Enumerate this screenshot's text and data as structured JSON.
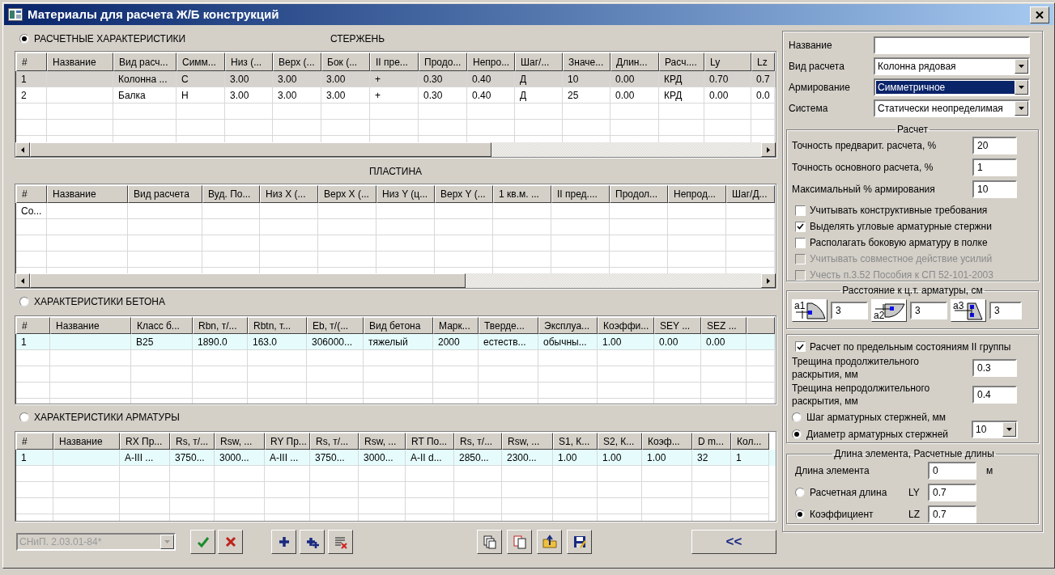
{
  "window": {
    "title": "Материалы для расчета Ж/Б конструкций"
  },
  "sections": [
    {
      "label": "РАСЧЕТНЫЕ ХАРАКТЕРИСТИКИ",
      "selected": true,
      "grids": [
        {
          "heading": "СТЕРЖЕНЬ",
          "columns": [
            "#",
            "Название",
            "Вид расч...",
            "Симм...",
            "Низ (...",
            "Верх (...",
            "Бок (...",
            "II пре...",
            "Продо...",
            "Непро...",
            "Шаг/...",
            "Значе...",
            "Длин...",
            "Расч....",
            "Ly",
            "Lz"
          ],
          "rows": [
            {
              "selected": true,
              "cells": [
                "1",
                null,
                "Колонна ...",
                "С",
                "3.00",
                "3.00",
                "3.00",
                "+",
                "0.30",
                "0.40",
                "Д",
                "10",
                "0.00",
                "КРД",
                "0.70",
                "0.7"
              ]
            },
            {
              "selected": false,
              "cells": [
                "2",
                null,
                "Балка",
                "Н",
                "3.00",
                "3.00",
                "3.00",
                "+",
                "0.30",
                "0.40",
                "Д",
                "25",
                "0.00",
                "КРД",
                "0.00",
                "0.0"
              ]
            }
          ]
        },
        {
          "heading": "ПЛАСТИНА",
          "columns": [
            "#",
            "Название",
            "Вид расчета",
            "Вуд. По...",
            "Низ X (...",
            "Верх X (...",
            "Низ Y (ц...",
            "Верх Y (...",
            "1 кв.м. ...",
            "II пред....",
            "Продол...",
            "Непрод...",
            "Шаг/Д..."
          ],
          "rows": [
            {
              "selected": false,
              "cells": [
                "Со..."
              ]
            }
          ]
        }
      ]
    },
    {
      "label": "ХАРАКТЕРИСТИКИ БЕТОНА",
      "selected": false,
      "grids": [
        {
          "columns": [
            "#",
            "Название",
            "Класс б...",
            "Rbn, т/...",
            "Rbtn, т...",
            "Eb, т/(...",
            "Вид бетона",
            "Марк...",
            "Тверде...",
            "Эксплуа...",
            "Коэффи...",
            "SEY ...",
            "SEZ ..."
          ],
          "rows": [
            {
              "selected": true,
              "cells": [
                "1",
                null,
                "В25",
                "1890.0",
                "163.0",
                "306000...",
                "тяжелый",
                "2000",
                "естеств...",
                "обычны...",
                "1.00",
                "0.00",
                "0.00"
              ]
            }
          ]
        }
      ]
    },
    {
      "label": "ХАРАКТЕРИСТИКИ АРМАТУРЫ",
      "selected": false,
      "grids": [
        {
          "columns": [
            "#",
            "Название",
            "RX Пр...",
            "Rs, т/...",
            "Rsw, ...",
            "RY Пр...",
            "Rs, т/...",
            "Rsw, ...",
            "RT По...",
            "Rs, т/...",
            "Rsw, ...",
            "S1, К...",
            "S2, К...",
            "Коэф...",
            "D m...",
            "Кол..."
          ],
          "rows": [
            {
              "selected": true,
              "cells": [
                "1",
                null,
                "А-III ...",
                "3750...",
                "3000...",
                "А-III ...",
                "3750...",
                "3000...",
                "А-II d...",
                "2850...",
                "2300...",
                "1.00",
                "1.00",
                "1.00",
                "32",
                "1"
              ]
            }
          ]
        }
      ]
    }
  ],
  "toolbar": {
    "standard": {
      "value": "СНиП. 2.03.01-84*",
      "disabled": true
    },
    "button_groups": [
      [
        {
          "kind": "apply"
        },
        {
          "kind": "cancel"
        }
      ],
      [
        {
          "kind": "add"
        },
        {
          "kind": "add-multiple"
        },
        {
          "kind": "delete"
        }
      ],
      [
        {
          "kind": "copy"
        },
        {
          "kind": "paste"
        },
        {
          "kind": "import"
        },
        {
          "kind": "save"
        }
      ]
    ],
    "collapse": "<<"
  },
  "properties": [
    {
      "kind": "text",
      "label": "Название"
    },
    {
      "kind": "combo",
      "label": "Вид расчета",
      "value": "Колонна рядовая",
      "focused": false
    },
    {
      "kind": "combo",
      "label": "Армирование",
      "value": "Симметричное",
      "focused": true
    },
    {
      "kind": "combo",
      "label": "Система",
      "value": "Статически неопределимая",
      "focused": false
    }
  ],
  "calculation": {
    "title": "Расчет",
    "fields": [
      {
        "label": "Точность предварит. расчета, %",
        "value": "20"
      },
      {
        "label": "Точность основного расчета, %",
        "value": "1"
      },
      {
        "label": "Максимальный % армирования",
        "value": "10"
      }
    ],
    "checkboxes": [
      {
        "label": "Учитывать конструктивные требования",
        "checked": false,
        "disabled": false
      },
      {
        "label": "Выделять угловые арматурные стержни",
        "checked": true,
        "disabled": false
      },
      {
        "label": "Располагать боковую арматуру в полке",
        "checked": false,
        "disabled": false
      },
      {
        "label": "Учитывать совместное действие усилий",
        "checked": false,
        "disabled": true
      },
      {
        "label": "Учесть п.3.52 Пособия к СП 52-101-2003",
        "checked": false,
        "disabled": true
      }
    ]
  },
  "cover": {
    "title": "Расстояние к ц.т. арматуры, см",
    "items": [
      {
        "icon_label": "a1",
        "value": "3"
      },
      {
        "icon_label": "a2",
        "value": "3"
      },
      {
        "icon_label": "a3",
        "value": "3"
      }
    ]
  },
  "crack": {
    "checkbox": {
      "label": "Расчет по предельным состояниям II группы",
      "checked": true
    },
    "fields": [
      {
        "label": "Трещина продолжительного раскрытия, мм",
        "value": "0.3"
      },
      {
        "label": "Трещина непродолжительного раскрытия, мм",
        "value": "0.4"
      }
    ],
    "radios": [
      {
        "label": "Шаг арматурных стержней, мм",
        "selected": false
      },
      {
        "label": "Диаметр арматурных стержней",
        "selected": true
      }
    ],
    "combo": {
      "value": "10"
    }
  },
  "length": {
    "title": "Длина элемента, Расчетные длины",
    "element": {
      "label": "Длина элемента",
      "value": "0",
      "unit": "м"
    },
    "radios": [
      {
        "label": "Расчетная длина",
        "selected": false,
        "axis": "LY",
        "value": "0.7"
      },
      {
        "label": "Коэффициент",
        "selected": true,
        "axis": "LZ",
        "value": "0.7"
      }
    ]
  }
}
